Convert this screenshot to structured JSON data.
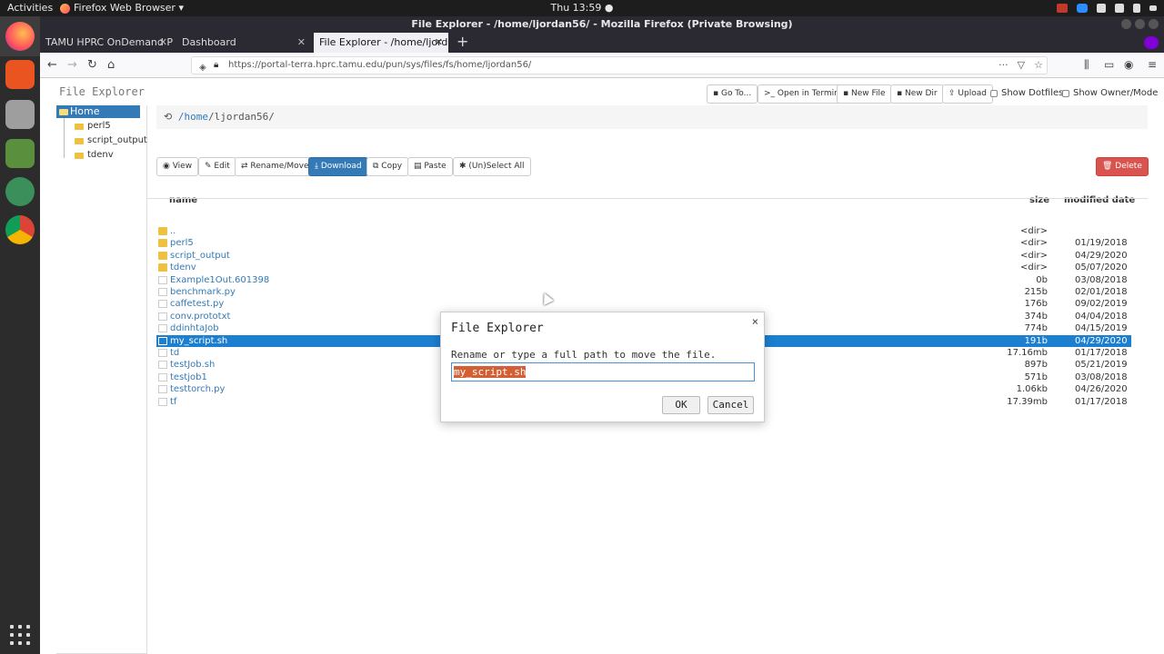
{
  "topbar": {
    "activities": "Activities",
    "app_menu": "Firefox Web Browser ▾",
    "clock": "Thu 13:59 ●"
  },
  "window": {
    "title": "File Explorer - /home/ljordan56/ - Mozilla Firefox (Private Browsing)"
  },
  "tabs": [
    {
      "label": "TAMU HPRC OnDemand Po"
    },
    {
      "label": "Dashboard"
    },
    {
      "label": "File Explorer - /home/ljorda"
    }
  ],
  "nav": {
    "url": "https://portal-terra.hprc.tamu.edu/pun/sys/files/fs/home/ljordan56/"
  },
  "page": {
    "brand": "File Explorer",
    "toolbar": {
      "goto": "Go To...",
      "terminal": ">_ Open in Terminal",
      "new_file": "New File",
      "new_dir": "New Dir",
      "upload": "Upload",
      "show_dotfiles": "Show Dotfiles",
      "show_owner": "Show Owner/Mode"
    },
    "tree": {
      "root": "Home Directory",
      "items": [
        "perl5",
        "script_output",
        "tdenv"
      ]
    },
    "breadcrumb": {
      "slash1": "/",
      "home": "home",
      "slash2": "/",
      "user": "ljordan56/"
    },
    "actions": {
      "view": "View",
      "edit": "Edit",
      "rename": "Rename/Move",
      "download": "Download",
      "copy": "Copy",
      "paste": "Paste",
      "select_all": "(Un)Select All",
      "delete": "Delete"
    },
    "columns": {
      "name": "name",
      "size": "size",
      "modified": "modified date"
    },
    "files": [
      {
        "name": "..",
        "size": "<dir>",
        "date": "",
        "type": "dir"
      },
      {
        "name": "perl5",
        "size": "<dir>",
        "date": "01/19/2018",
        "type": "dir"
      },
      {
        "name": "script_output",
        "size": "<dir>",
        "date": "04/29/2020",
        "type": "dir"
      },
      {
        "name": "tdenv",
        "size": "<dir>",
        "date": "05/07/2020",
        "type": "dir"
      },
      {
        "name": "Example1Out.601398",
        "size": "0b",
        "date": "03/08/2018",
        "type": "file"
      },
      {
        "name": "benchmark.py",
        "size": "215b",
        "date": "02/01/2018",
        "type": "file"
      },
      {
        "name": "caffetest.py",
        "size": "176b",
        "date": "09/02/2019",
        "type": "file"
      },
      {
        "name": "conv.prototxt",
        "size": "374b",
        "date": "04/04/2018",
        "type": "file"
      },
      {
        "name": "ddinhtaJob",
        "size": "774b",
        "date": "04/15/2019",
        "type": "file"
      },
      {
        "name": "my_script.sh",
        "size": "191b",
        "date": "04/29/2020",
        "type": "file",
        "selected": true
      },
      {
        "name": "td",
        "size": "17.16mb",
        "date": "01/17/2018",
        "type": "file"
      },
      {
        "name": "testJob.sh",
        "size": "897b",
        "date": "05/21/2019",
        "type": "file"
      },
      {
        "name": "testjob1",
        "size": "571b",
        "date": "03/08/2018",
        "type": "file"
      },
      {
        "name": "testtorch.py",
        "size": "1.06kb",
        "date": "04/26/2020",
        "type": "file"
      },
      {
        "name": "tf",
        "size": "17.39mb",
        "date": "01/17/2018",
        "type": "file"
      }
    ]
  },
  "dialog": {
    "title": "File Explorer",
    "close": "×",
    "message": "Rename or type a full path to move the file.",
    "value": "my_script.sh",
    "ok": "OK",
    "cancel": "Cancel"
  },
  "colors": {
    "primary": "#337ab7",
    "danger": "#d9534f",
    "selected_row": "#1c7fd0",
    "text_selection": "#d35f35"
  }
}
